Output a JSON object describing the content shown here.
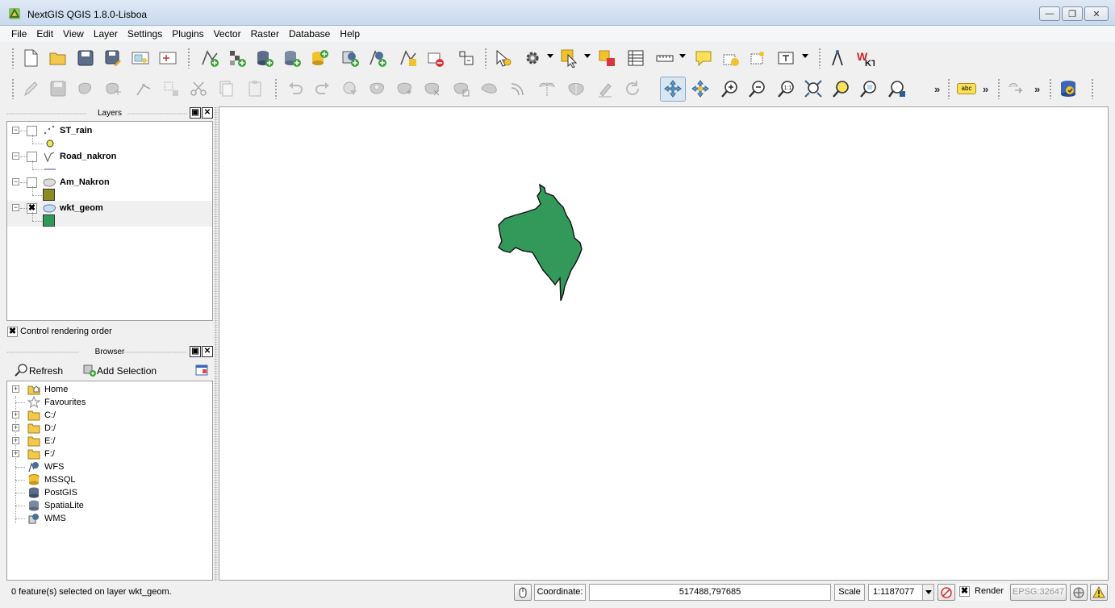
{
  "window": {
    "title": "NextGIS QGIS 1.8.0-Lisboa"
  },
  "menu": [
    "File",
    "Edit",
    "View",
    "Layer",
    "Settings",
    "Plugins",
    "Vector",
    "Raster",
    "Database",
    "Help"
  ],
  "toolbar": {
    "overflow": "»",
    "label_text": "abc"
  },
  "layers_panel": {
    "title": "Layers",
    "layers": [
      {
        "name": "ST_rain",
        "checked": false,
        "type": "point"
      },
      {
        "name": "Road_nakron",
        "checked": false,
        "type": "line"
      },
      {
        "name": "Am_Nakron",
        "checked": false,
        "type": "polygon",
        "color": "#8b8b1f"
      },
      {
        "name": "wkt_geom",
        "checked": true,
        "type": "polygon",
        "color": "#2e9a55"
      }
    ],
    "checked_mark": "✖",
    "control_rendering_order": "Control rendering order"
  },
  "browser_panel": {
    "title": "Browser",
    "refresh": "Refresh",
    "add_selection": "Add Selection",
    "items": [
      {
        "label": "Home",
        "icon": "home-folder-icon",
        "expandable": true
      },
      {
        "label": "Favourites",
        "icon": "star-icon",
        "expandable": false
      },
      {
        "label": "C:/",
        "icon": "folder-icon",
        "expandable": true
      },
      {
        "label": "D:/",
        "icon": "folder-icon",
        "expandable": true
      },
      {
        "label": "E:/",
        "icon": "folder-icon",
        "expandable": true
      },
      {
        "label": "F:/",
        "icon": "folder-icon",
        "expandable": true
      },
      {
        "label": "WFS",
        "icon": "wfs-icon",
        "expandable": false
      },
      {
        "label": "MSSQL",
        "icon": "database-icon",
        "expandable": false
      },
      {
        "label": "PostGIS",
        "icon": "database-icon",
        "expandable": false
      },
      {
        "label": "SpatiaLite",
        "icon": "database-icon",
        "expandable": false
      },
      {
        "label": "WMS",
        "icon": "wms-icon",
        "expandable": false
      }
    ]
  },
  "map": {
    "feature_color": "#33995a",
    "outline_color": "#111111"
  },
  "status": {
    "message": "0 feature(s) selected on layer wkt_geom.",
    "coordinate_label": "Coordinate:",
    "coordinate_value": "517488,797685",
    "scale_label": "Scale",
    "scale_value": "1:1187077",
    "render_label": "Render",
    "render_checked": "✖",
    "crs": "EPSG:32647"
  },
  "window_controls": {
    "minimize": "—",
    "maximize": "❐",
    "close": "✕"
  }
}
